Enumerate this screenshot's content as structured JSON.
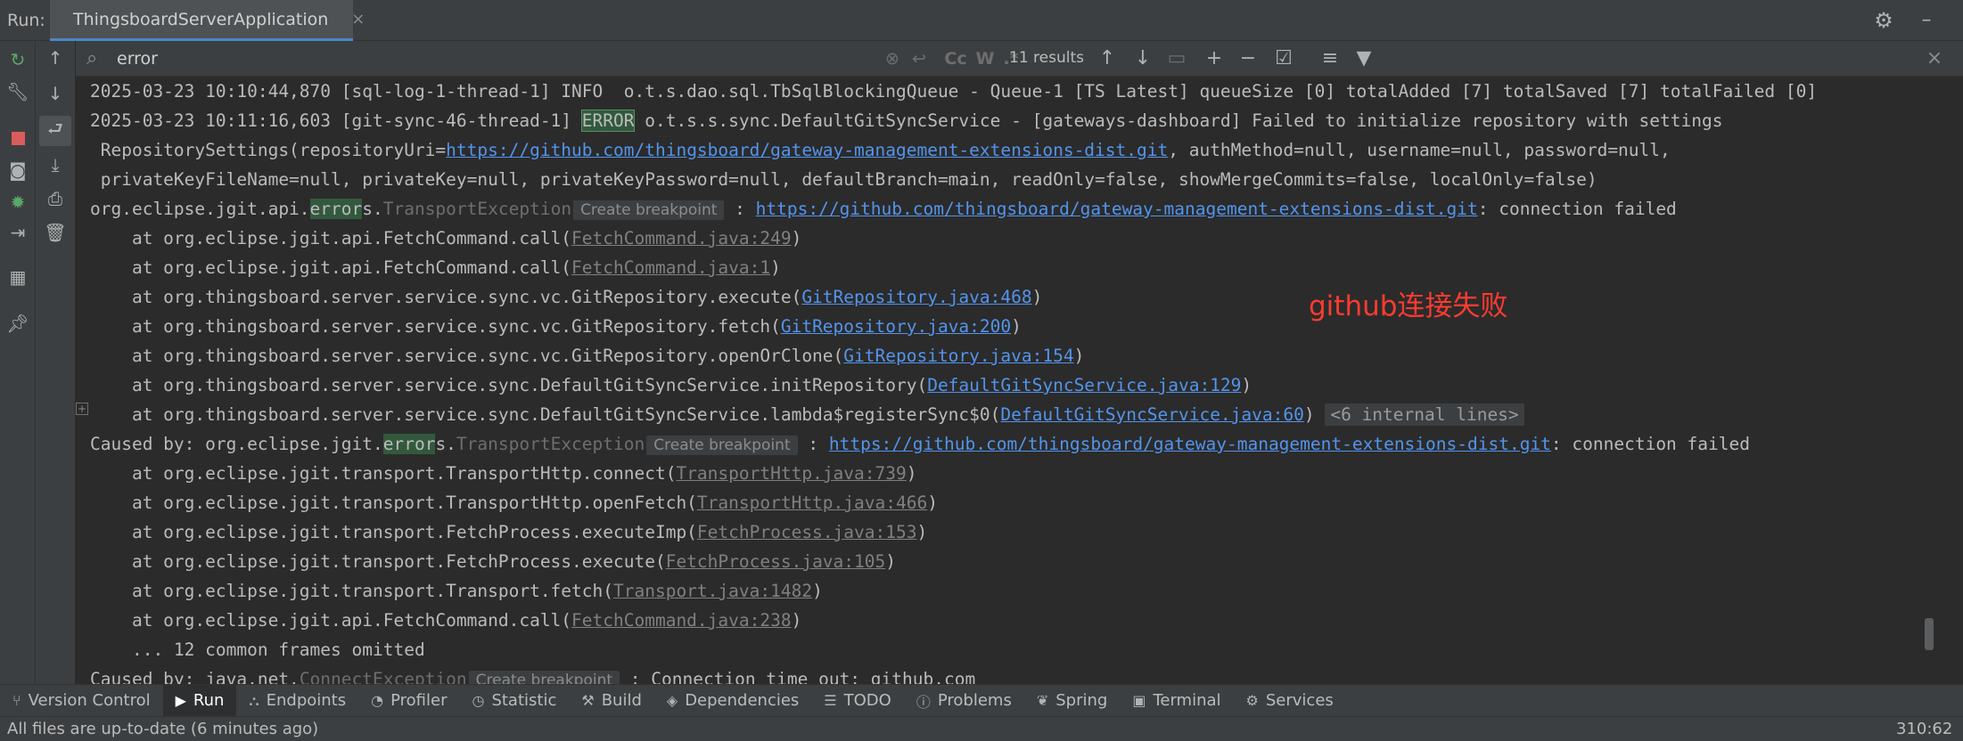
{
  "header": {
    "run_label": "Run:",
    "tab_title": "ThingsboardServerApplication",
    "tab_close": "×"
  },
  "search": {
    "value": "error",
    "results": "11 results",
    "match_case": "Cc",
    "whole_word": "W",
    "regex": ".*"
  },
  "console_lines": [
    [
      {
        "t": "2025-03-23 10:10:44,870 [sql-log-1-thread-1] INFO  o.t.s.dao.sql.TbSqlBlockingQueue - Queue-1 [TS Latest] queueSize [0] totalAdded [7] totalSaved [7] totalFailed [0]"
      }
    ],
    [
      {
        "t": "2025-03-23 10:11:16,603 [git-sync-46-thread-1] "
      },
      {
        "t": "ERROR",
        "c": "hl-box"
      },
      {
        "t": " o.t.s.s.sync.DefaultGitSyncService - [gateways-dashboard] Failed to initialize repository with settings"
      }
    ],
    [
      {
        "t": " RepositorySettings(repositoryUri="
      },
      {
        "t": "https://github.com/thingsboard/gateway-management-extensions-dist.git",
        "c": "link"
      },
      {
        "t": ", authMethod=null, username=null, password=null,"
      }
    ],
    [
      {
        "t": " privateKeyFileName=null, privateKey=null, privateKeyPassword=null, defaultBranch=main, readOnly=false, showMergeCommits=false, localOnly=false)"
      }
    ],
    [
      {
        "t": "org.eclipse.jgit.api."
      },
      {
        "t": "error",
        "c": "hl"
      },
      {
        "t": "s."
      },
      {
        "t": "TransportException",
        "c": "ghost"
      },
      {
        "t": "Create breakpoint",
        "c": "chip"
      },
      {
        "t": " : "
      },
      {
        "t": "https://github.com/thingsboard/gateway-management-extensions-dist.git",
        "c": "link"
      },
      {
        "t": ": connection failed"
      }
    ],
    [
      {
        "t": "    at org.eclipse.jgit.api.FetchCommand.call("
      },
      {
        "t": "FetchCommand.java:249",
        "c": "glink"
      },
      {
        "t": ")"
      }
    ],
    [
      {
        "t": "    at org.eclipse.jgit.api.FetchCommand.call("
      },
      {
        "t": "FetchCommand.java:1",
        "c": "glink"
      },
      {
        "t": ")"
      }
    ],
    [
      {
        "t": "    at org.thingsboard.server.service.sync.vc.GitRepository.execute("
      },
      {
        "t": "GitRepository.java:468",
        "c": "link"
      },
      {
        "t": ")"
      }
    ],
    [
      {
        "t": "    at org.thingsboard.server.service.sync.vc.GitRepository.fetch("
      },
      {
        "t": "GitRepository.java:200",
        "c": "link"
      },
      {
        "t": ")"
      }
    ],
    [
      {
        "t": "    at org.thingsboard.server.service.sync.vc.GitRepository.openOrClone("
      },
      {
        "t": "GitRepository.java:154",
        "c": "link"
      },
      {
        "t": ")"
      }
    ],
    [
      {
        "t": "    at org.thingsboard.server.service.sync.DefaultGitSyncService.initRepository("
      },
      {
        "t": "DefaultGitSyncService.java:129",
        "c": "link"
      },
      {
        "t": ")"
      }
    ],
    [
      {
        "t": "    at org.thingsboard.server.service.sync.DefaultGitSyncService.lambda$registerSync$0("
      },
      {
        "t": "DefaultGitSyncService.java:60",
        "c": "link"
      },
      {
        "t": ") "
      },
      {
        "t": "<6 internal lines>",
        "c": "chip-internal"
      }
    ],
    [
      {
        "t": "Caused by: org.eclipse.jgit."
      },
      {
        "t": "error",
        "c": "hl"
      },
      {
        "t": "s."
      },
      {
        "t": "TransportException",
        "c": "ghost"
      },
      {
        "t": "Create breakpoint",
        "c": "chip"
      },
      {
        "t": " : "
      },
      {
        "t": "https://github.com/thingsboard/gateway-management-extensions-dist.git",
        "c": "link"
      },
      {
        "t": ": connection failed"
      }
    ],
    [
      {
        "t": "    at org.eclipse.jgit.transport.TransportHttp.connect("
      },
      {
        "t": "TransportHttp.java:739",
        "c": "glink"
      },
      {
        "t": ")"
      }
    ],
    [
      {
        "t": "    at org.eclipse.jgit.transport.TransportHttp.openFetch("
      },
      {
        "t": "TransportHttp.java:466",
        "c": "glink"
      },
      {
        "t": ")"
      }
    ],
    [
      {
        "t": "    at org.eclipse.jgit.transport.FetchProcess.executeImp("
      },
      {
        "t": "FetchProcess.java:153",
        "c": "glink"
      },
      {
        "t": ")"
      }
    ],
    [
      {
        "t": "    at org.eclipse.jgit.transport.FetchProcess.execute("
      },
      {
        "t": "FetchProcess.java:105",
        "c": "glink"
      },
      {
        "t": ")"
      }
    ],
    [
      {
        "t": "    at org.eclipse.jgit.transport.Transport.fetch("
      },
      {
        "t": "Transport.java:1482",
        "c": "glink"
      },
      {
        "t": ")"
      }
    ],
    [
      {
        "t": "    at org.eclipse.jgit.api.FetchCommand.call("
      },
      {
        "t": "FetchCommand.java:238",
        "c": "glink"
      },
      {
        "t": ")"
      }
    ],
    [
      {
        "t": "    ... 12 common frames omitted"
      }
    ],
    [
      {
        "t": "Caused by: java.net."
      },
      {
        "t": "ConnectException",
        "c": "ghost"
      },
      {
        "t": "Create breakpoint",
        "c": "chip"
      },
      {
        "t": " : Connection time out: github.com"
      }
    ]
  ],
  "annotation": "github连接失败",
  "tool_tabs": [
    {
      "icon": "⑂",
      "label": "Version Control",
      "name": "version-control"
    },
    {
      "icon": "▶",
      "label": "Run",
      "name": "run",
      "active": true
    },
    {
      "icon": "⛬",
      "label": "Endpoints",
      "name": "endpoints"
    },
    {
      "icon": "◔",
      "label": "Profiler",
      "name": "profiler"
    },
    {
      "icon": "◷",
      "label": "Statistic",
      "name": "statistic"
    },
    {
      "icon": "⚒",
      "label": "Build",
      "name": "build"
    },
    {
      "icon": "◈",
      "label": "Dependencies",
      "name": "dependencies"
    },
    {
      "icon": "☰",
      "label": "TODO",
      "name": "todo"
    },
    {
      "icon": "ⓘ",
      "label": "Problems",
      "name": "problems"
    },
    {
      "icon": "❦",
      "label": "Spring",
      "name": "spring"
    },
    {
      "icon": "▣",
      "label": "Terminal",
      "name": "terminal"
    },
    {
      "icon": "⚙",
      "label": "Services",
      "name": "services"
    }
  ],
  "status": {
    "message": "All files are up-to-date (6 minutes ago)",
    "position": "310:62"
  },
  "colors": {
    "error_link": "#5394ec",
    "annotation": "#ff3b30",
    "match_highlight": "#32593d"
  }
}
